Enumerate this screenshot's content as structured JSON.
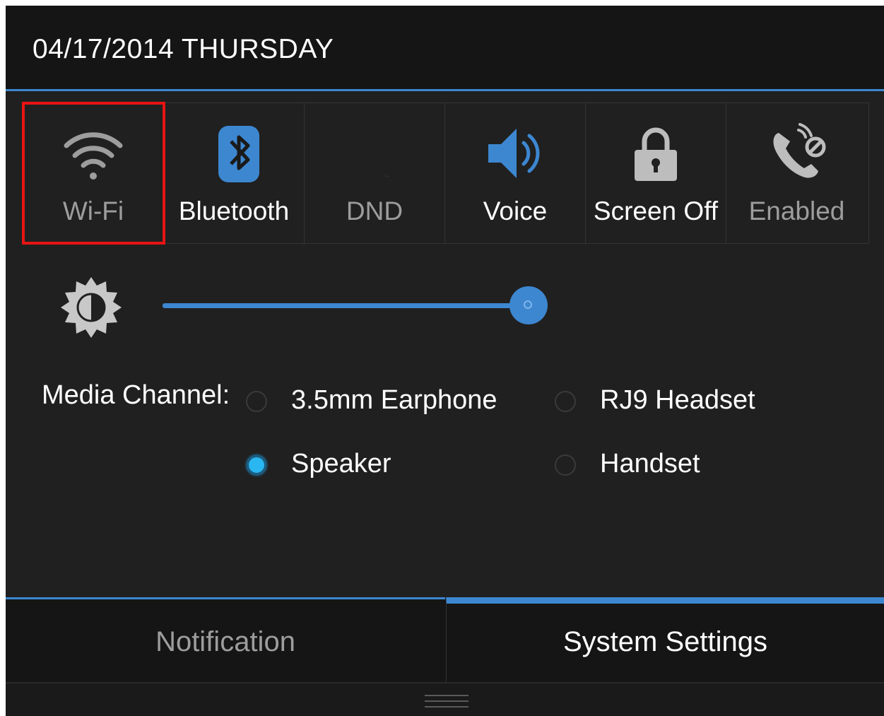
{
  "header": {
    "date": "04/17/2014 THURSDAY"
  },
  "tiles": [
    {
      "label": "Wi-Fi",
      "icon": "wifi-icon",
      "dim": true,
      "selected": true
    },
    {
      "label": "Bluetooth",
      "icon": "bluetooth-icon",
      "dim": false
    },
    {
      "label": "DND",
      "icon": "moon-icon",
      "dim": true
    },
    {
      "label": "Voice",
      "icon": "speaker-icon",
      "dim": false
    },
    {
      "label": "Screen Off",
      "icon": "lock-icon",
      "dim": false
    },
    {
      "label": "Enabled",
      "icon": "call-blocked-icon",
      "dim": true
    }
  ],
  "brightness": {
    "icon": "brightness-icon",
    "level": 0.95
  },
  "media_channel": {
    "label": "Media Channel:",
    "options": [
      {
        "label": "3.5mm Earphone",
        "checked": false
      },
      {
        "label": "RJ9 Headset",
        "checked": false
      },
      {
        "label": "Speaker",
        "checked": true
      },
      {
        "label": "Handset",
        "checked": false
      }
    ]
  },
  "tabs": [
    {
      "label": "Notification",
      "active": false
    },
    {
      "label": "System Settings",
      "active": true
    }
  ],
  "colors": {
    "accent": "#3d87d1",
    "highlight": "#e81414",
    "radio_checked": "#2ab6f0"
  },
  "handle": {
    "icon": "drag-handle-icon"
  }
}
